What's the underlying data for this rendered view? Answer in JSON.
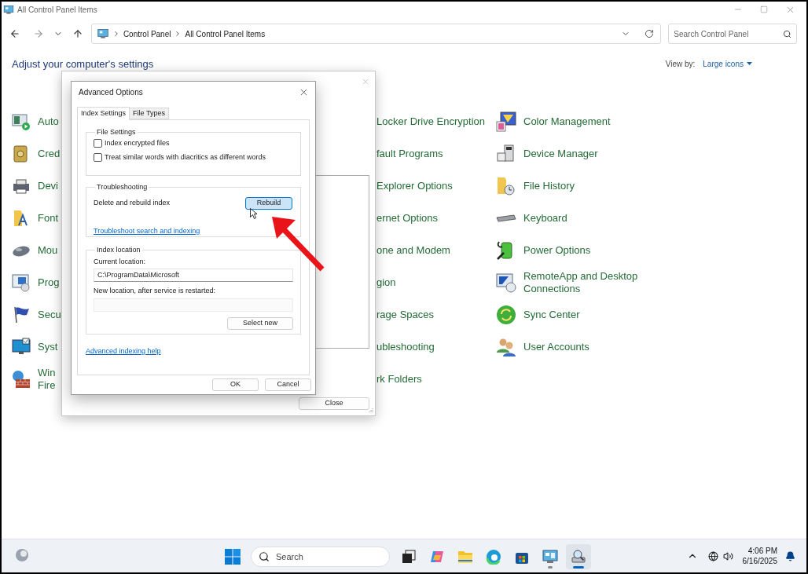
{
  "window": {
    "title": "All Control Panel Items"
  },
  "address_bar": {
    "path": [
      {
        "label": "Control Panel"
      },
      {
        "label": "All Control Panel Items"
      }
    ]
  },
  "search": {
    "placeholder": "Search Control Panel"
  },
  "heading": "Adjust your computer's settings",
  "view_by": {
    "label": "View by:",
    "value": "Large icons"
  },
  "items_column_1": [
    {
      "label": "Auto"
    },
    {
      "label": "Cred"
    },
    {
      "label": "Devi"
    },
    {
      "label": "Font"
    },
    {
      "label": "Mou"
    },
    {
      "label": "Prog"
    },
    {
      "label": "Secu"
    },
    {
      "label": "Syst"
    },
    {
      "label": "Win\nFire"
    }
  ],
  "items_column_2": [
    {
      "label": "Locker Drive Encryption"
    },
    {
      "label": "fault Programs"
    },
    {
      "label": "Explorer Options"
    },
    {
      "label": "ernet Options"
    },
    {
      "label": "one and Modem"
    },
    {
      "label": "gion"
    },
    {
      "label": "rage Spaces"
    },
    {
      "label": "ubleshooting"
    },
    {
      "label": "rk Folders"
    }
  ],
  "items_column_3": [
    {
      "label": "Color Management"
    },
    {
      "label": "Device Manager"
    },
    {
      "label": "File History"
    },
    {
      "label": "Keyboard"
    },
    {
      "label": "Power Options"
    },
    {
      "label": "RemoteApp and Desktop Connections"
    },
    {
      "label": "Sync Center"
    },
    {
      "label": "User Accounts"
    }
  ],
  "indexing_options": {
    "buttons": [
      {
        "label": "Close"
      }
    ]
  },
  "advanced_options": {
    "title": "Advanced Options",
    "tabs": [
      {
        "label": "Index Settings",
        "selected": true
      },
      {
        "label": "File Types",
        "selected": false
      }
    ],
    "file_settings": {
      "legend": "File Settings",
      "options": [
        {
          "label": "Index encrypted files",
          "checked": false
        },
        {
          "label": "Treat similar words with diacritics as different words",
          "checked": false
        }
      ]
    },
    "troubleshooting": {
      "legend": "Troubleshooting",
      "text": "Delete and rebuild index",
      "button": {
        "label": "Rebuild",
        "hovered": true
      },
      "link": "Troubleshoot search and indexing"
    },
    "index_location": {
      "legend": "Index location",
      "current_label": "Current location:",
      "current_value": "C:\\ProgramData\\Microsoft",
      "new_label": "New location, after service is restarted:",
      "new_disabled": true,
      "button": "Select new"
    },
    "help_link": "Advanced indexing help",
    "buttons": [
      {
        "label": "OK"
      },
      {
        "label": "Cancel"
      }
    ]
  },
  "taskbar": {
    "search": {
      "placeholder": "Search"
    },
    "apps": [
      {
        "kind": "task-view",
        "running": false,
        "selected": false
      },
      {
        "kind": "copilot",
        "running": false,
        "selected": false
      },
      {
        "kind": "file-explorer",
        "running": false,
        "selected": false
      },
      {
        "kind": "edge",
        "running": false,
        "selected": false
      },
      {
        "kind": "store",
        "running": false,
        "selected": false
      },
      {
        "kind": "control-panel",
        "running": true,
        "selected": false
      },
      {
        "kind": "indexing",
        "running": true,
        "selected": true
      }
    ],
    "time": "4:06 PM",
    "date": "6/16/2025"
  }
}
